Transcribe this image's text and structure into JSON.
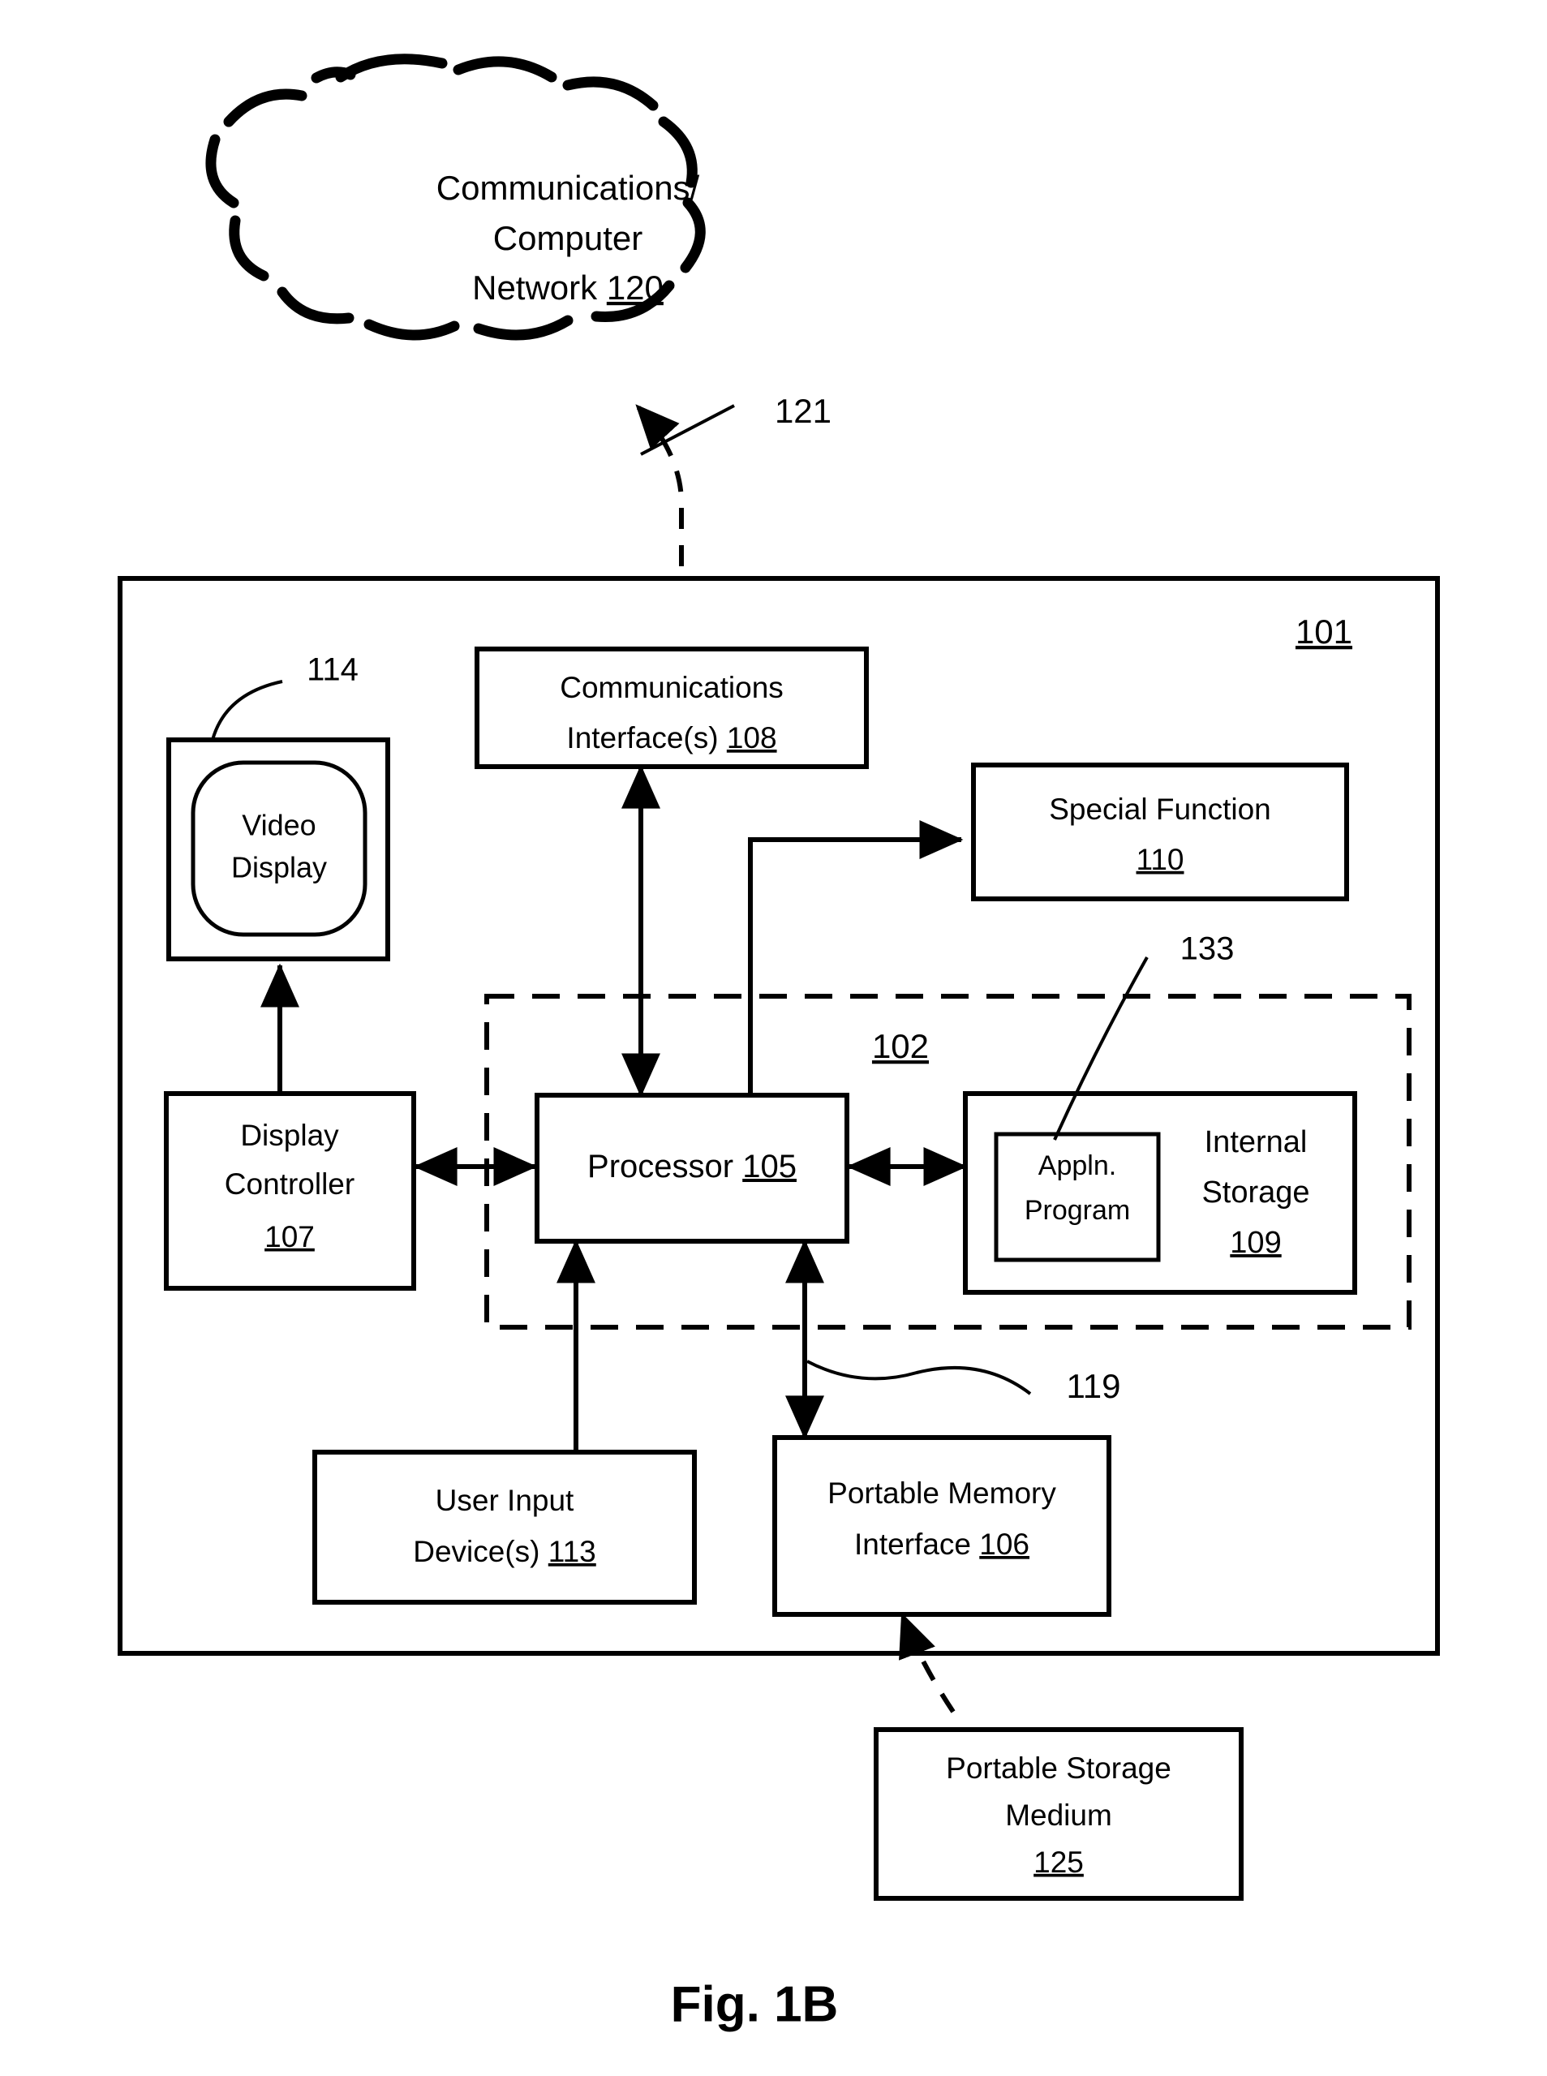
{
  "figure": {
    "caption": "Fig. 1B",
    "title": "Computer system block diagram"
  },
  "cloud": {
    "line1": "Communications/",
    "line2": "Computer",
    "line3_text": "Network ",
    "line3_ref": "120"
  },
  "blocks": {
    "communications_interface": {
      "line1": "Communications",
      "line2_text": "Interface(s) ",
      "line2_ref": "108"
    },
    "special_function": {
      "line1": "Special Function",
      "line2_ref": "110"
    },
    "video_display": {
      "line1": "Video",
      "line2": "Display"
    },
    "display_controller": {
      "line1": "Display",
      "line2": "Controller",
      "line3_ref": "107"
    },
    "processor": {
      "line1_text": "Processor ",
      "line1_ref": "105"
    },
    "internal_storage": {
      "line1": "Internal",
      "line2": "Storage",
      "line3_ref": "109"
    },
    "appln_program": {
      "line1": "Appln.",
      "line2": "Program"
    },
    "user_input_device": {
      "line1": "User Input",
      "line2_text": "Device(s) ",
      "line2_ref": "113"
    },
    "portable_memory_interface": {
      "line1": "Portable Memory",
      "line2_text": "Interface ",
      "line2_ref": "106"
    },
    "portable_storage_medium": {
      "line1": "Portable Storage",
      "line2": "Medium",
      "line3_ref": "125"
    }
  },
  "reference_numerals": {
    "computer_system": "101",
    "core_subsystem": "102",
    "video_display_lead": "114",
    "network_link": "121",
    "memory_link": "119",
    "appln_program_lead": "133"
  },
  "colors": {
    "ink": "#000000",
    "paper": "#ffffff"
  }
}
